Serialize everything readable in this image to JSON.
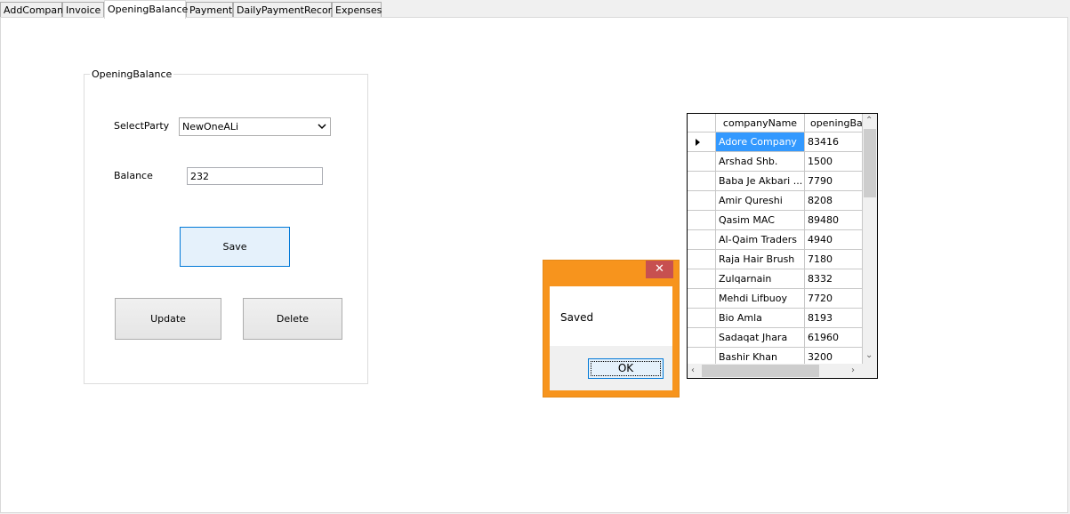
{
  "tabs": [
    "AddCompany",
    "Invoice",
    "OpeningBalance",
    "Payment",
    "DailyPaymentRecord",
    "Expenses"
  ],
  "active_tab": "OpeningBalance",
  "groupbox": {
    "title": "OpeningBalance",
    "select_party_label": "SelectParty",
    "select_party_value": "NewOneALi",
    "balance_label": "Balance",
    "balance_value": "232",
    "save_label": "Save",
    "update_label": "Update",
    "delete_label": "Delete"
  },
  "message_box": {
    "text": "Saved",
    "ok_label": "OK",
    "close_icon": "close-icon",
    "title_bar_color": "#f7941d"
  },
  "grid": {
    "columns": [
      "companyName",
      "openingBala"
    ],
    "rows": [
      [
        "Adore Company",
        "83416"
      ],
      [
        "Arshad Shb.",
        "1500"
      ],
      [
        "Baba Je Akbari ...",
        "7790"
      ],
      [
        "Amir Qureshi",
        "8208"
      ],
      [
        "Qasim MAC",
        "89480"
      ],
      [
        "Al-Qaim Traders",
        "4940"
      ],
      [
        "Raja Hair Brush",
        "7180"
      ],
      [
        "Zulqarnain",
        "8332"
      ],
      [
        "Mehdi Lifbuoy",
        "7720"
      ],
      [
        "Bio Amla",
        "8193"
      ],
      [
        "Sadaqat Jhara",
        "61960"
      ],
      [
        "Bashir Khan",
        "3200"
      ]
    ],
    "selected_row": 0,
    "selection_color": "#3399ff"
  }
}
